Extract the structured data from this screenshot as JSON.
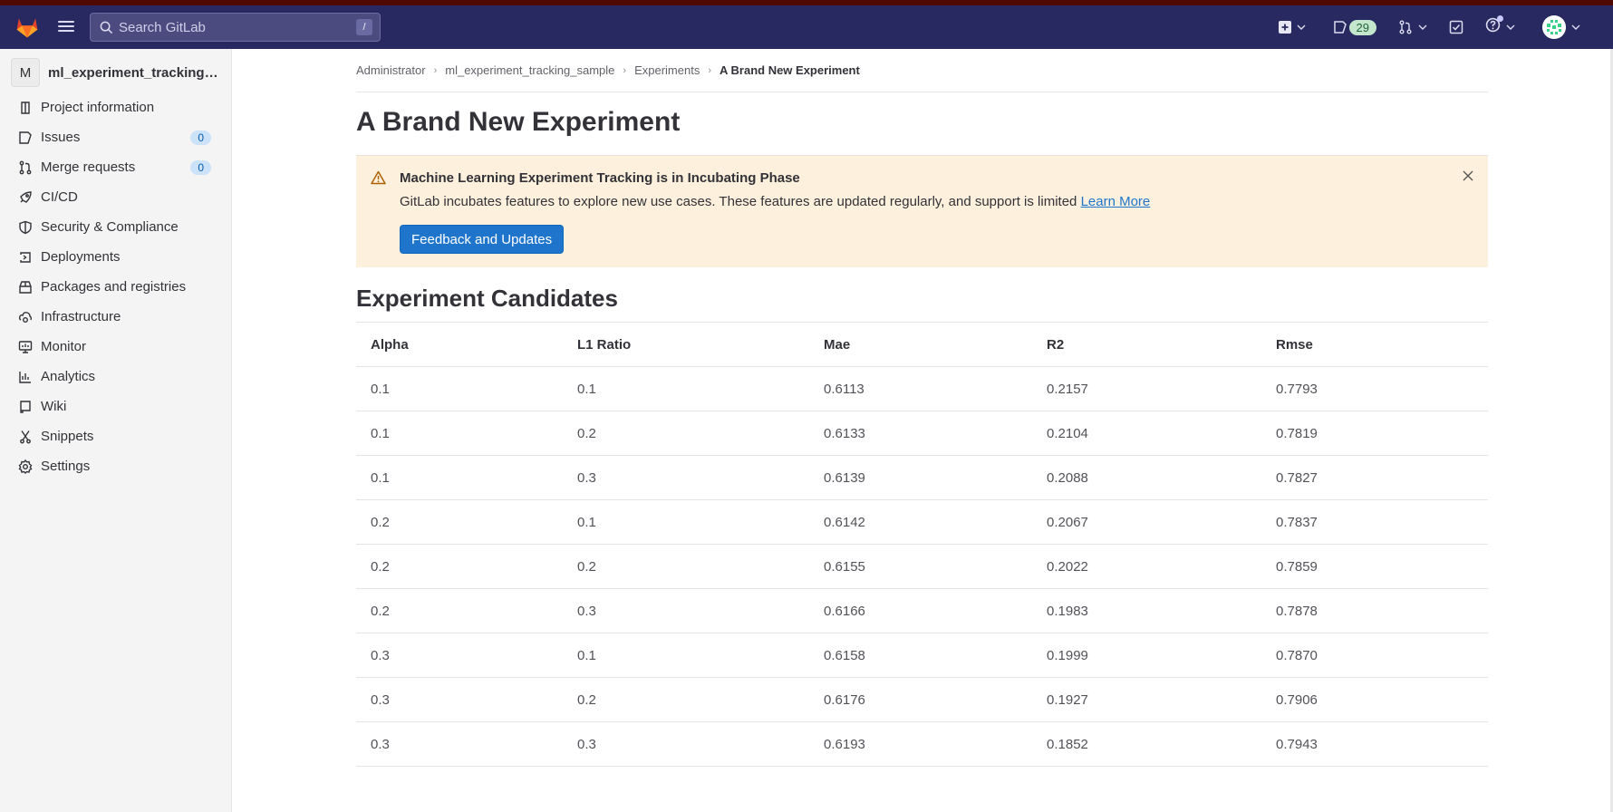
{
  "navbar": {
    "search_placeholder": "Search GitLab",
    "search_shortcut": "/",
    "issues_count": "29",
    "icons": [
      "gitlab-logo",
      "hamburger-menu",
      "search-icon",
      "new-item-icon",
      "issues-icon",
      "merge-request-icon",
      "todo-icon",
      "help-icon",
      "user-avatar"
    ]
  },
  "sidebar": {
    "project_initial": "M",
    "project_name": "ml_experiment_tracking_sample",
    "items": [
      {
        "label": "Project information",
        "icon": "project-icon"
      },
      {
        "label": "Issues",
        "icon": "issues-icon",
        "count": "0"
      },
      {
        "label": "Merge requests",
        "icon": "merge-request-icon",
        "count": "0"
      },
      {
        "label": "CI/CD",
        "icon": "rocket-icon"
      },
      {
        "label": "Security & Compliance",
        "icon": "shield-icon"
      },
      {
        "label": "Deployments",
        "icon": "deployments-icon"
      },
      {
        "label": "Packages and registries",
        "icon": "package-icon"
      },
      {
        "label": "Infrastructure",
        "icon": "cloud-gear-icon"
      },
      {
        "label": "Monitor",
        "icon": "monitor-icon"
      },
      {
        "label": "Analytics",
        "icon": "analytics-icon"
      },
      {
        "label": "Wiki",
        "icon": "book-icon"
      },
      {
        "label": "Snippets",
        "icon": "snippet-icon"
      },
      {
        "label": "Settings",
        "icon": "settings-icon"
      }
    ]
  },
  "breadcrumb": [
    "Administrator",
    "ml_experiment_tracking_sample",
    "Experiments",
    "A Brand New Experiment"
  ],
  "page_title": "A Brand New Experiment",
  "alert": {
    "title": "Machine Learning Experiment Tracking is in Incubating Phase",
    "body": "GitLab incubates features to explore new use cases. These features are updated regularly, and support is limited",
    "link": "Learn More",
    "button": "Feedback and Updates"
  },
  "candidates": {
    "title": "Experiment Candidates",
    "columns": [
      "Alpha",
      "L1 Ratio",
      "Mae",
      "R2",
      "Rmse"
    ],
    "rows": [
      [
        "0.1",
        "0.1",
        "0.6113",
        "0.2157",
        "0.7793"
      ],
      [
        "0.1",
        "0.2",
        "0.6133",
        "0.2104",
        "0.7819"
      ],
      [
        "0.1",
        "0.3",
        "0.6139",
        "0.2088",
        "0.7827"
      ],
      [
        "0.2",
        "0.1",
        "0.6142",
        "0.2067",
        "0.7837"
      ],
      [
        "0.2",
        "0.2",
        "0.6155",
        "0.2022",
        "0.7859"
      ],
      [
        "0.2",
        "0.3",
        "0.6166",
        "0.1983",
        "0.7878"
      ],
      [
        "0.3",
        "0.1",
        "0.6158",
        "0.1999",
        "0.7870"
      ],
      [
        "0.3",
        "0.2",
        "0.6176",
        "0.1927",
        "0.7906"
      ],
      [
        "0.3",
        "0.3",
        "0.6193",
        "0.1852",
        "0.7943"
      ]
    ]
  }
}
